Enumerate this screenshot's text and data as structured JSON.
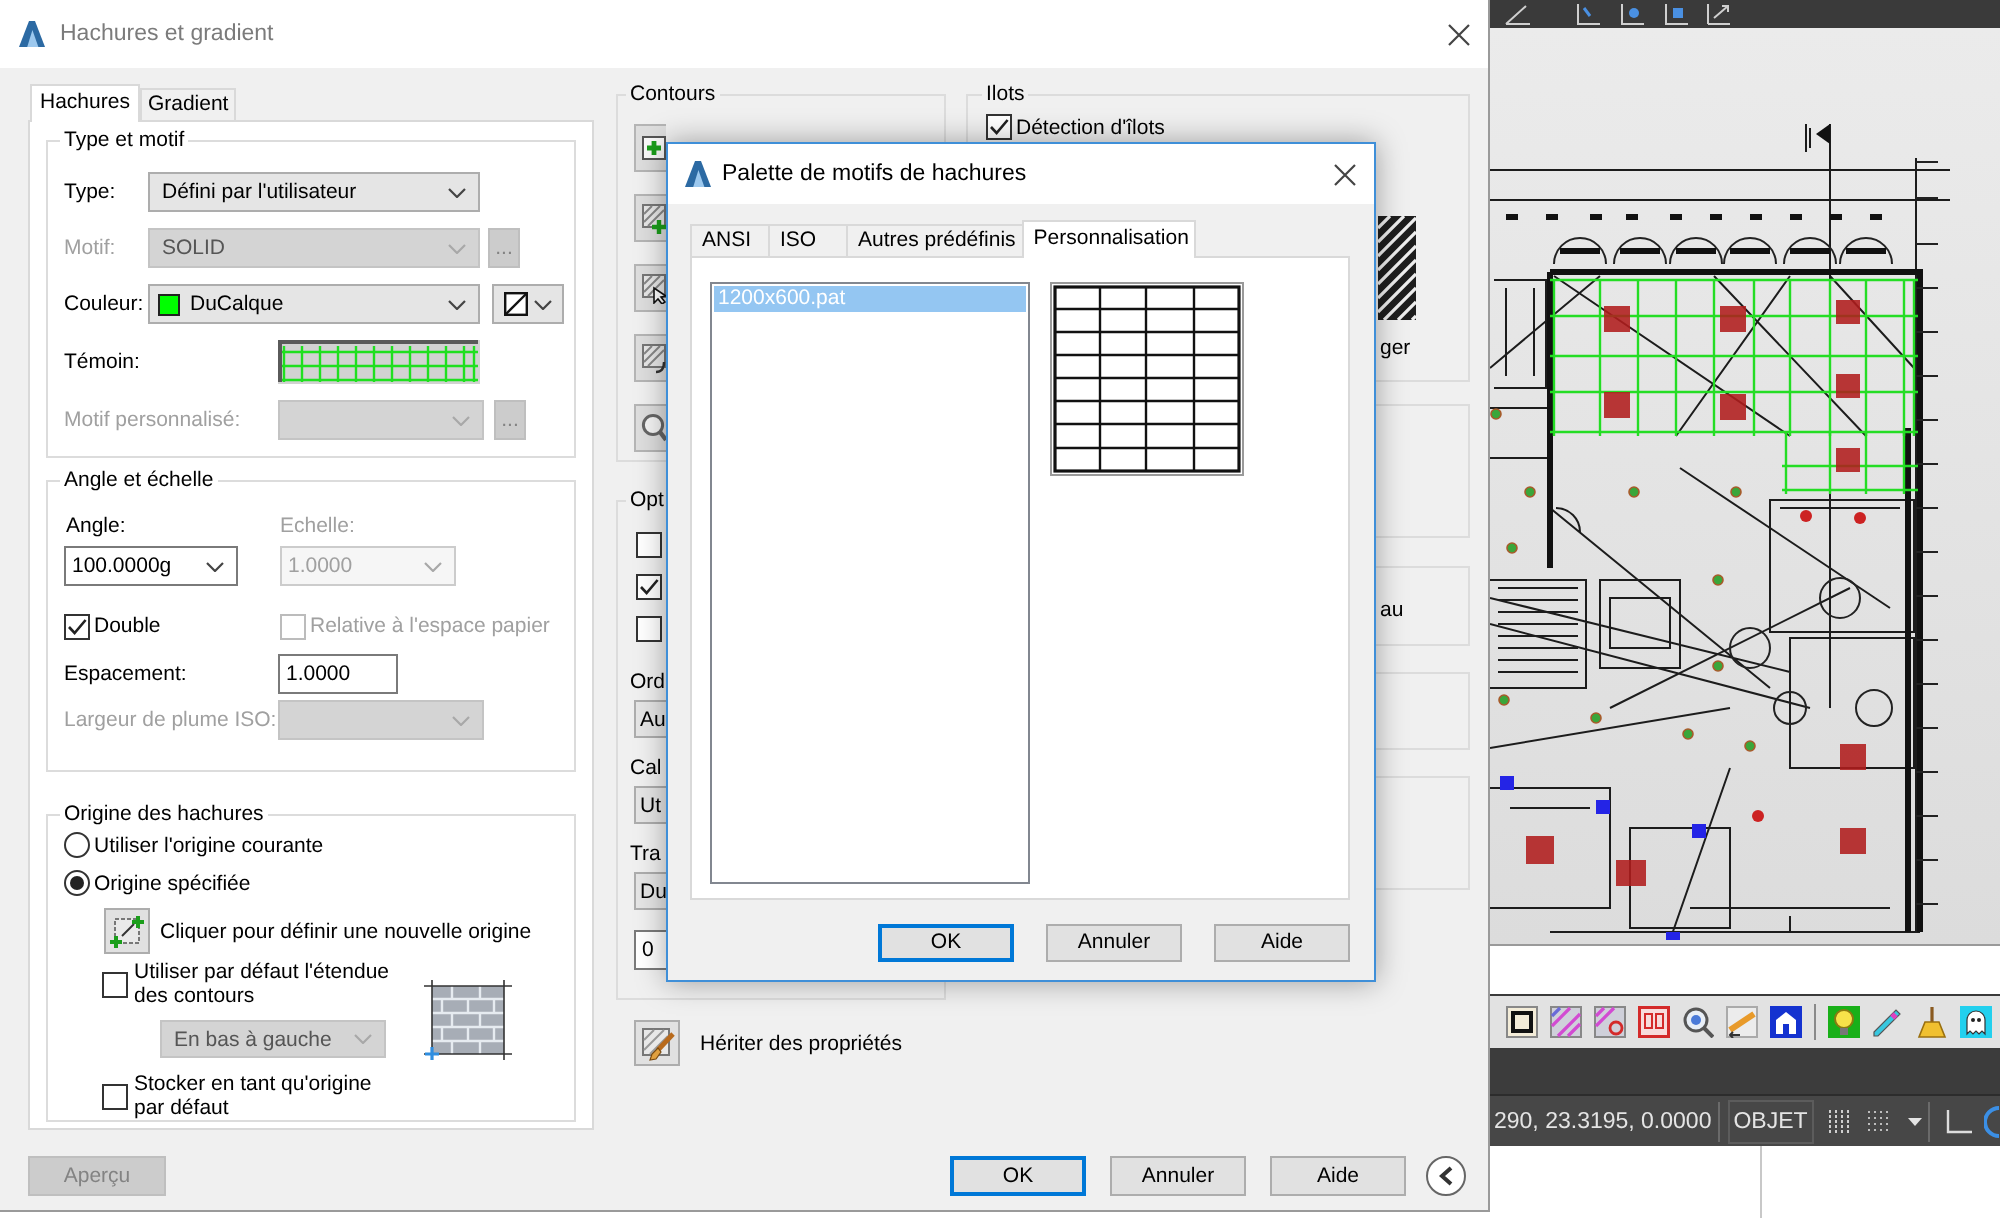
{
  "dialog": {
    "title": "Hachures et gradient",
    "tabs": [
      {
        "label": "Hachures",
        "selected": true
      },
      {
        "label": "Gradient",
        "selected": false
      }
    ],
    "type_and_pattern": {
      "title": "Type et motif",
      "type": {
        "label": "Type:",
        "value": "Défini par l'utilisateur",
        "disabled": false
      },
      "pattern": {
        "label": "Motif:",
        "value": "SOLID",
        "browse": "...",
        "disabled": true
      },
      "color": {
        "label": "Couleur:",
        "value": "DuCalque",
        "disabled": false
      },
      "sample": {
        "label": "Témoin:"
      },
      "custom_pattern": {
        "label": "Motif personnalisé:",
        "browse": "...",
        "disabled": true
      }
    },
    "angle_and_scale": {
      "title": "Angle et échelle",
      "angle": {
        "label": "Angle:",
        "value": "100.0000g",
        "disabled": false
      },
      "scale": {
        "label": "Echelle:",
        "value": "1.0000",
        "disabled": true
      },
      "double": {
        "label": "Double",
        "checked": true,
        "disabled": false
      },
      "relative_to_paper_space": {
        "label": "Relative à l'espace papier",
        "checked": false,
        "disabled": true
      },
      "spacing": {
        "label": "Espacement:",
        "value": "1.0000"
      },
      "iso_pen_width": {
        "label": "Largeur de plume ISO:",
        "disabled": true
      }
    },
    "hatch_origin": {
      "title": "Origine des hachures",
      "options": [
        {
          "label": "Utiliser l'origine courante",
          "selected": false
        },
        {
          "label": "Origine spécifiée",
          "selected": true
        }
      ],
      "set_new_origin": "Cliquer pour définir une nouvelle origine",
      "default_to_boundary_extents": {
        "label": "Utiliser par défaut l'étendue des contours",
        "checked": false
      },
      "extents_position": {
        "value": "En bas à gauche",
        "disabled": true
      },
      "store_as_default": {
        "label": "Stocker en tant qu'origine par défaut",
        "checked": false
      }
    },
    "preview_button": {
      "label": "Aperçu",
      "disabled": true
    },
    "boundaries": {
      "title": "Contours"
    },
    "options": {
      "title": "Opt",
      "checkboxes": [
        {
          "checked": false
        },
        {
          "checked": true
        },
        {
          "checked": false
        }
      ],
      "fields": [
        {
          "label": "Ord",
          "value": "Au"
        },
        {
          "label": "Cal",
          "value": "Ut"
        },
        {
          "label": "Tra",
          "value": "Du"
        }
      ],
      "value": "0"
    },
    "islands": {
      "title": "Ilots",
      "detection": {
        "label": "Détection d'îlots",
        "checked": true
      },
      "style_label": "ger"
    },
    "group_label": "au",
    "inherit_properties": "Hériter des propriétés",
    "buttons": [
      {
        "label": "OK",
        "default": true
      },
      {
        "label": "Annuler",
        "default": false
      },
      {
        "label": "Aide",
        "default": false
      }
    ]
  },
  "pattern_palette": {
    "title": "Palette de motifs de hachures",
    "tabs": [
      {
        "label": "ANSI",
        "selected": false
      },
      {
        "label": "ISO",
        "selected": false
      },
      {
        "label": "Autres prédéfinis",
        "selected": false
      },
      {
        "label": "Personnalisation",
        "selected": true
      }
    ],
    "patterns": [
      {
        "name": "1200x600.pat",
        "selected": true
      }
    ],
    "buttons": [
      {
        "label": "OK",
        "default": true
      },
      {
        "label": "Annuler",
        "default": false
      },
      {
        "label": "Aide",
        "default": false
      }
    ]
  },
  "status_bar": {
    "coordinates": "290, 23.3195, 0.0000",
    "mode": "OBJET"
  }
}
